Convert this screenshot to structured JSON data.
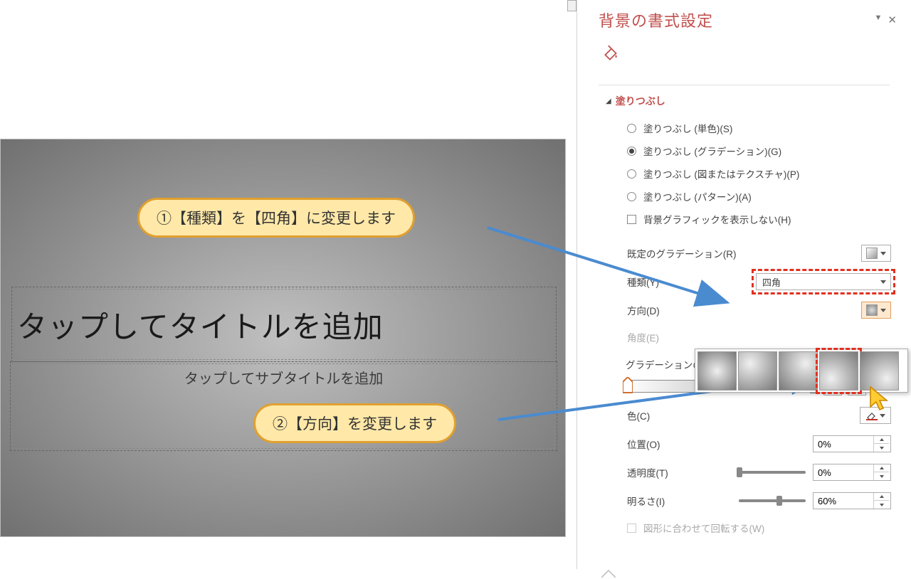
{
  "panel": {
    "title": "背景の書式設定",
    "section_fill": "塗りつぶし",
    "radios": {
      "solid": "塗りつぶし (単色)(S)",
      "gradient": "塗りつぶし (グラデーション)(G)",
      "picture": "塗りつぶし (図またはテクスチャ)(P)",
      "pattern": "塗りつぶし (パターン)(A)"
    },
    "hide_bg": "背景グラフィックを表示しない(H)",
    "preset_label": "既定のグラデーション(R)",
    "type_label": "種類(Y)",
    "type_value": "四角",
    "direction_label": "方向(D)",
    "angle_label": "角度(E)",
    "stops_label": "グラデーションの分岐点",
    "color_label": "色(C)",
    "position_label": "位置(O)",
    "position_value": "0%",
    "transparency_label": "透明度(T)",
    "transparency_value": "0%",
    "brightness_label": "明るさ(I)",
    "brightness_value": "60%",
    "rotate_label": "図形に合わせて回転する(W)"
  },
  "slide": {
    "title": "タップしてタイトルを追加",
    "subtitle": "タップしてサブタイトルを追加"
  },
  "callouts": {
    "c1": "①【種類】を【四角】に変更します",
    "c2": "②【方向】を変更します"
  }
}
